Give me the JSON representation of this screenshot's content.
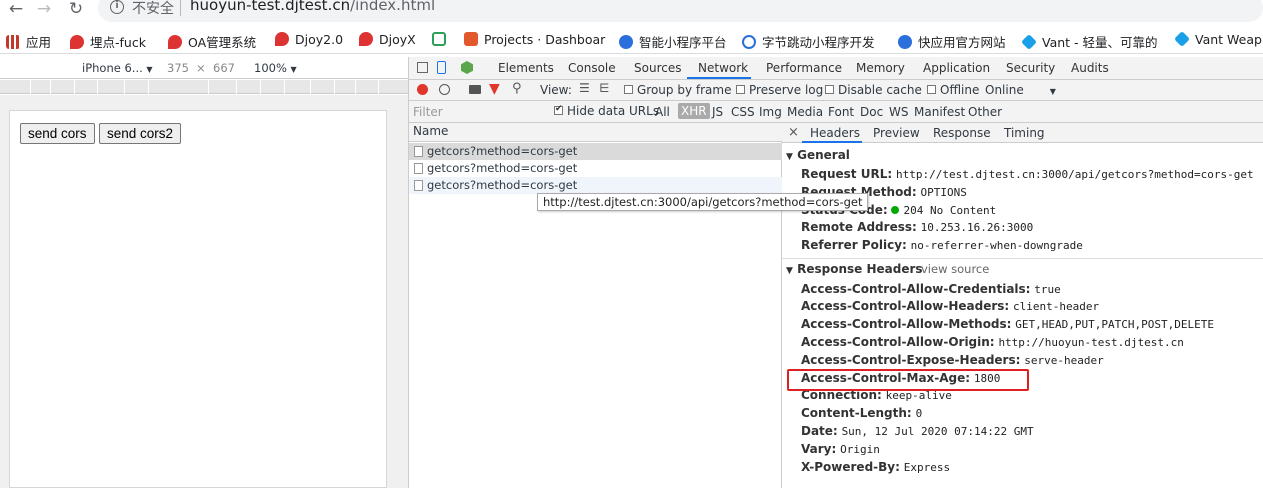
{
  "browser": {
    "insecure_label": "不安全",
    "url_host": "huoyun-test.djtest.cn",
    "url_path": "/index.html"
  },
  "bookmarks": [
    {
      "label": "应用",
      "color": "#c0392b"
    },
    {
      "label": "埋点-fuck",
      "color": "#d33"
    },
    {
      "label": "OA管理系统",
      "color": "#d33"
    },
    {
      "label": "Djoy2.0",
      "color": "#d33"
    },
    {
      "label": "DjoyX",
      "color": "#d33"
    },
    {
      "label": "",
      "color": "#2e9f5a"
    },
    {
      "label": "Projects · Dashboar",
      "color": "#e2572b"
    },
    {
      "label": "智能小程序平台",
      "color": "#2a6fdb"
    },
    {
      "label": "字节跳动小程序开发",
      "color": "#2a6fdb"
    },
    {
      "label": "快应用官方网站",
      "color": "#2a6fdb"
    },
    {
      "label": "Vant - 轻量、可靠的",
      "color": "#1aa0e8"
    },
    {
      "label": "Vant Weapp",
      "color": "#1aa0e8"
    }
  ],
  "device_toolbar": {
    "device": "iPhone 6...",
    "width": "375",
    "times": "×",
    "height": "667",
    "zoom": "100%"
  },
  "page": {
    "buttons": [
      "send cors",
      "send cors2"
    ]
  },
  "devtools": {
    "tabs": [
      "Elements",
      "Console",
      "Sources",
      "Network",
      "Performance",
      "Memory",
      "Application",
      "Security",
      "Audits"
    ],
    "active_tab": "Network",
    "toolbar": {
      "view_label": "View:",
      "group_by_frame": "Group by frame",
      "preserve_log": "Preserve log",
      "disable_cache": "Disable cache",
      "offline": "Offline",
      "online": "Online"
    },
    "filter": {
      "placeholder": "Filter",
      "hide_data_urls": "Hide data URLs",
      "types": [
        "All",
        "XHR",
        "JS",
        "CSS",
        "Img",
        "Media",
        "Font",
        "Doc",
        "WS",
        "Manifest",
        "Other"
      ],
      "active_type": "XHR"
    },
    "list": {
      "column": "Name",
      "rows": [
        "getcors?method=cors-get",
        "getcors?method=cors-get",
        "getcors?method=cors-get"
      ],
      "tooltip": "http://test.djtest.cn:3000/api/getcors?method=cors-get"
    },
    "detail": {
      "close": "×",
      "tabs": [
        "Headers",
        "Preview",
        "Response",
        "Timing"
      ],
      "active_tab": "Headers",
      "general_title": "General",
      "general": [
        {
          "k": "Request URL:",
          "v": "http://test.djtest.cn:3000/api/getcors?method=cors-get"
        },
        {
          "k": "Request Method:",
          "v": "OPTIONS"
        },
        {
          "k": "Status Code:",
          "v": "204 No Content"
        },
        {
          "k": "Remote Address:",
          "v": "10.253.16.26:3000"
        },
        {
          "k": "Referrer Policy:",
          "v": "no-referrer-when-downgrade"
        }
      ],
      "response_title": "Response Headers",
      "view_source": "view source",
      "response": [
        {
          "k": "Access-Control-Allow-Credentials:",
          "v": "true"
        },
        {
          "k": "Access-Control-Allow-Headers:",
          "v": "client-header"
        },
        {
          "k": "Access-Control-Allow-Methods:",
          "v": "GET,HEAD,PUT,PATCH,POST,DELETE"
        },
        {
          "k": "Access-Control-Allow-Origin:",
          "v": "http://huoyun-test.djtest.cn"
        },
        {
          "k": "Access-Control-Expose-Headers:",
          "v": "serve-header"
        },
        {
          "k": "Access-Control-Max-Age:",
          "v": "1800"
        },
        {
          "k": "Connection:",
          "v": "keep-alive"
        },
        {
          "k": "Content-Length:",
          "v": "0"
        },
        {
          "k": "Date:",
          "v": "Sun, 12 Jul 2020 07:14:22 GMT"
        },
        {
          "k": "Vary:",
          "v": "Origin"
        },
        {
          "k": "X-Powered-By:",
          "v": "Express"
        }
      ]
    }
  },
  "colors": {
    "accent": "#1a73e8",
    "record": "#e0362c",
    "status_ok": "#00aa00",
    "highlight": "#e02020"
  }
}
